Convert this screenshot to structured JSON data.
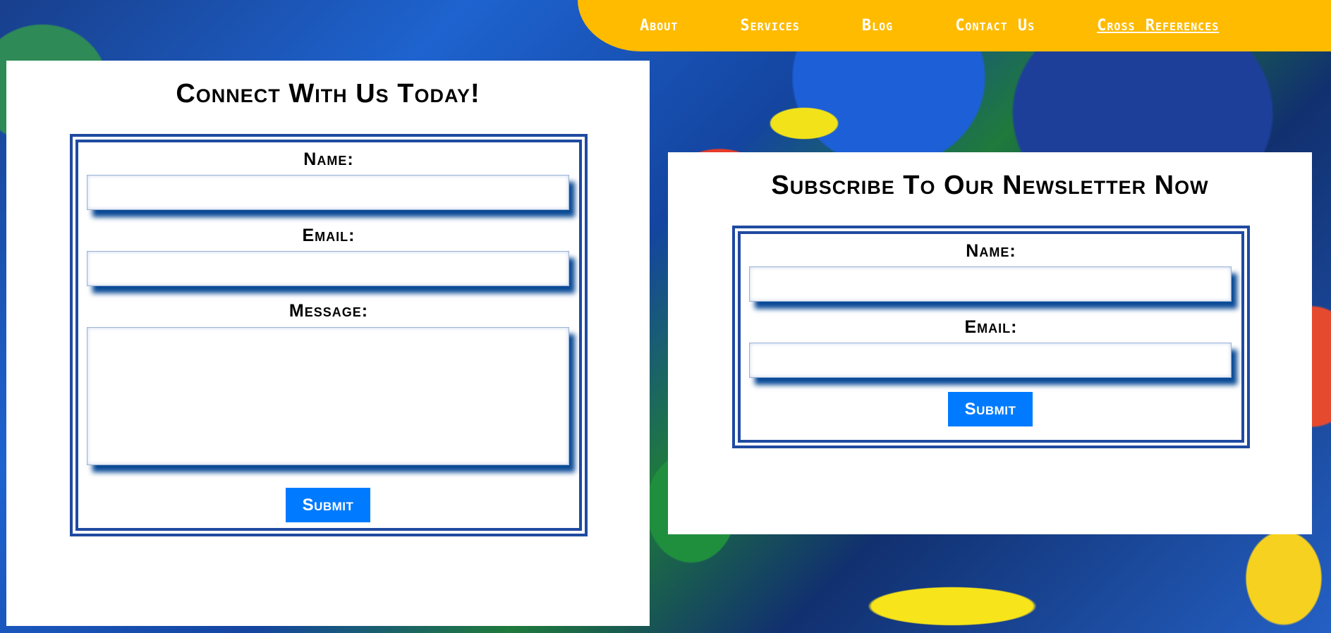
{
  "nav": {
    "items": [
      {
        "label": "About"
      },
      {
        "label": "Services"
      },
      {
        "label": "Blog"
      },
      {
        "label": "Contact Us"
      },
      {
        "label": "Cross References"
      }
    ]
  },
  "contact_form": {
    "title": "Connect With Us Today!",
    "name_label": "Name:",
    "name_value": "",
    "email_label": "Email:",
    "email_value": "",
    "message_label": "Message:",
    "message_value": "",
    "submit_label": "Submit"
  },
  "newsletter_form": {
    "title": "Subscribe To Our Newsletter Now",
    "name_label": "Name:",
    "name_value": "",
    "email_label": "Email:",
    "email_value": "",
    "submit_label": "Submit"
  },
  "colors": {
    "nav_background": "#ffbb00",
    "form_border": "#1f4aa0",
    "input_shadow": "#0a4a96",
    "submit_button": "#007bff"
  }
}
